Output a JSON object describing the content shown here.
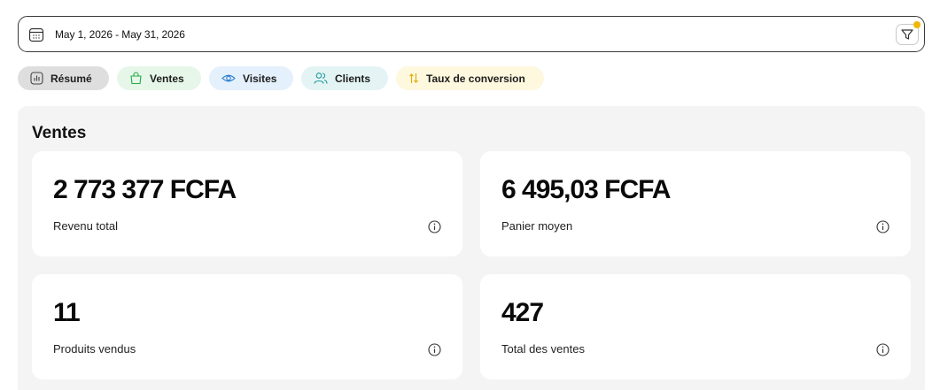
{
  "date_range": {
    "text": "May 1, 2026 - May 31, 2026"
  },
  "tabs": [
    {
      "label": "Résumé",
      "icon": "bar-chart-icon",
      "color": "#dddedd"
    },
    {
      "label": "Ventes",
      "icon": "shopping-bag-icon",
      "color": "#e6f7e9"
    },
    {
      "label": "Visites",
      "icon": "eye-icon",
      "color": "#e4f0fb"
    },
    {
      "label": "Clients",
      "icon": "users-icon",
      "color": "#e4f4f4"
    },
    {
      "label": "Taux de conversion",
      "icon": "sort-arrows-icon",
      "color": "#fdf8de"
    }
  ],
  "section": {
    "title": "Ventes"
  },
  "metrics": [
    {
      "value": "2 773 377 FCFA",
      "label": "Revenu total"
    },
    {
      "value": "6 495,03 FCFA",
      "label": "Panier moyen"
    },
    {
      "value": "11",
      "label": "Produits vendus"
    },
    {
      "value": "427",
      "label": "Total des ventes"
    }
  ],
  "colors": {
    "notification_dot": "#f2b705",
    "panel_bg": "#f3f4f3"
  }
}
